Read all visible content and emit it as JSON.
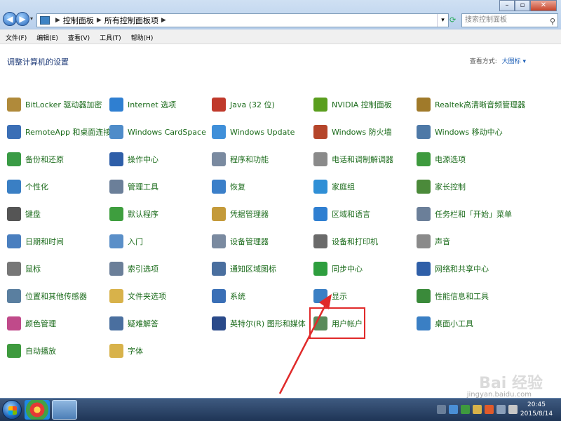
{
  "address": {
    "crumbs": [
      "控制面板",
      "所有控制面板项"
    ],
    "search_placeholder": "搜索控制面板"
  },
  "menu": [
    "文件(F)",
    "编辑(E)",
    "查看(V)",
    "工具(T)",
    "帮助(H)"
  ],
  "page_title": "调整计算机的设置",
  "view": {
    "label": "查看方式:",
    "value": "大图标 ▾"
  },
  "items": [
    {
      "label": "BitLocker 驱动器加密",
      "icon": "key-icon",
      "color": "#b08a3a"
    },
    {
      "label": "Internet 选项",
      "icon": "globe-icon",
      "color": "#2f7fd1"
    },
    {
      "label": "Java (32 位)",
      "icon": "java-icon",
      "color": "#c0392b"
    },
    {
      "label": "NVIDIA 控制面板",
      "icon": "nvidia-icon",
      "color": "#5a9e1e"
    },
    {
      "label": "Realtek高清晰音频管理器",
      "icon": "speaker-icon",
      "color": "#a07a2a"
    },
    {
      "label": "RemoteApp 和桌面连接",
      "icon": "remote-icon",
      "color": "#3b6fb6"
    },
    {
      "label": "Windows CardSpace",
      "icon": "cardspace-icon",
      "color": "#4f8cc9"
    },
    {
      "label": "Windows Update",
      "icon": "update-icon",
      "color": "#3f8fd9"
    },
    {
      "label": "Windows 防火墙",
      "icon": "firewall-icon",
      "color": "#b5452a"
    },
    {
      "label": "Windows 移动中心",
      "icon": "mobility-icon",
      "color": "#4e79a7"
    },
    {
      "label": "备份和还原",
      "icon": "backup-icon",
      "color": "#3a9b45"
    },
    {
      "label": "操作中心",
      "icon": "flag-icon",
      "color": "#2e5ea8"
    },
    {
      "label": "程序和功能",
      "icon": "programs-icon",
      "color": "#7a8aa0"
    },
    {
      "label": "电话和调制解调器",
      "icon": "phone-icon",
      "color": "#8a8a8a"
    },
    {
      "label": "电源选项",
      "icon": "power-icon",
      "color": "#3e9a3e"
    },
    {
      "label": "个性化",
      "icon": "personalize-icon",
      "color": "#3a7fc4"
    },
    {
      "label": "管理工具",
      "icon": "admin-tools-icon",
      "color": "#6b7f99"
    },
    {
      "label": "恢复",
      "icon": "recovery-icon",
      "color": "#3b7fc9"
    },
    {
      "label": "家庭组",
      "icon": "homegroup-icon",
      "color": "#2f8fd6"
    },
    {
      "label": "家长控制",
      "icon": "parental-icon",
      "color": "#4b8a3a"
    },
    {
      "label": "键盘",
      "icon": "keyboard-icon",
      "color": "#555555"
    },
    {
      "label": "默认程序",
      "icon": "default-programs-icon",
      "color": "#3e9e3e"
    },
    {
      "label": "凭据管理器",
      "icon": "credential-icon",
      "color": "#c49a3a"
    },
    {
      "label": "区域和语言",
      "icon": "region-icon",
      "color": "#2f7fd1"
    },
    {
      "label": "任务栏和「开始」菜单",
      "icon": "taskbar-icon",
      "color": "#6b7f99"
    },
    {
      "label": "日期和时间",
      "icon": "clock-icon",
      "color": "#4a7fbf"
    },
    {
      "label": "入门",
      "icon": "getting-started-icon",
      "color": "#5a8fc8"
    },
    {
      "label": "设备管理器",
      "icon": "device-manager-icon",
      "color": "#7a8aa0"
    },
    {
      "label": "设备和打印机",
      "icon": "printer-icon",
      "color": "#6a6a6a"
    },
    {
      "label": "声音",
      "icon": "sound-icon",
      "color": "#8a8a8a"
    },
    {
      "label": "鼠标",
      "icon": "mouse-icon",
      "color": "#777777"
    },
    {
      "label": "索引选项",
      "icon": "index-icon",
      "color": "#6b7f99"
    },
    {
      "label": "通知区域图标",
      "icon": "notification-icon",
      "color": "#4a6f9f"
    },
    {
      "label": "同步中心",
      "icon": "sync-icon",
      "color": "#2e9e3e"
    },
    {
      "label": "网络和共享中心",
      "icon": "network-icon",
      "color": "#2f5fa8"
    },
    {
      "label": "位置和其他传感器",
      "icon": "sensor-icon",
      "color": "#5a7fa0"
    },
    {
      "label": "文件夹选项",
      "icon": "folder-icon",
      "color": "#d8b24a"
    },
    {
      "label": "系统",
      "icon": "system-icon",
      "color": "#3a6fb6"
    },
    {
      "label": "显示",
      "icon": "display-icon",
      "color": "#3a7fc4"
    },
    {
      "label": "性能信息和工具",
      "icon": "performance-icon",
      "color": "#3a8a3a"
    },
    {
      "label": "颜色管理",
      "icon": "color-icon",
      "color": "#c04a8a"
    },
    {
      "label": "疑难解答",
      "icon": "troubleshoot-icon",
      "color": "#4a6f9f"
    },
    {
      "label": "英特尔(R) 图形和媒体",
      "icon": "intel-icon",
      "color": "#2a4a8a"
    },
    {
      "label": "用户帐户",
      "icon": "user-accounts-icon",
      "color": "#5a8a5a"
    },
    {
      "label": "桌面小工具",
      "icon": "gadgets-icon",
      "color": "#3a7fc4"
    },
    {
      "label": "自动播放",
      "icon": "autoplay-icon",
      "color": "#3e9a3e"
    },
    {
      "label": "字体",
      "icon": "fonts-icon",
      "color": "#d8b24a"
    }
  ],
  "taskbar": {
    "time": "20:45",
    "date": "2015/8/14"
  },
  "watermark": {
    "text": "Bai 经验",
    "sub": "jingyan.baidu.com"
  }
}
